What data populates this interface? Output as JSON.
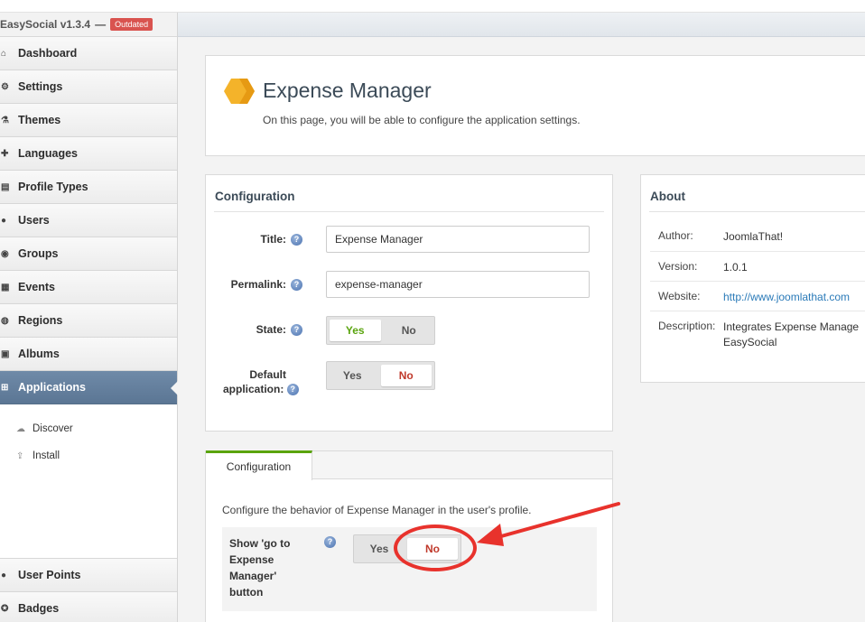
{
  "brand": {
    "name": "EasySocial v1.3.4",
    "separator": "—",
    "badge": "Outdated"
  },
  "sidebar": {
    "items": [
      {
        "label": "Dashboard",
        "icon": "home-icon"
      },
      {
        "label": "Settings",
        "icon": "gear-icon"
      },
      {
        "label": "Themes",
        "icon": "flask-icon"
      },
      {
        "label": "Languages",
        "icon": "puzzle-icon"
      },
      {
        "label": "Profile Types",
        "icon": "id-card-icon"
      },
      {
        "label": "Users",
        "icon": "user-icon"
      },
      {
        "label": "Groups",
        "icon": "group-icon"
      },
      {
        "label": "Events",
        "icon": "calendar-icon"
      },
      {
        "label": "Regions",
        "icon": "globe-icon"
      },
      {
        "label": "Albums",
        "icon": "album-icon"
      },
      {
        "label": "Applications",
        "icon": "plus-box-icon",
        "active": true
      }
    ],
    "subitems": [
      {
        "label": "Discover",
        "icon": "cloud-icon"
      },
      {
        "label": "Install",
        "icon": "upload-icon"
      }
    ],
    "bottom_items": [
      {
        "label": "User Points",
        "icon": "circle-icon"
      },
      {
        "label": "Badges",
        "icon": "badge-icon"
      }
    ]
  },
  "page": {
    "title": "Expense Manager",
    "description": "On this page, you will be able to configure the application settings."
  },
  "config": {
    "heading": "Configuration",
    "title_label": "Title:",
    "title_value": "Expense Manager",
    "permalink_label": "Permalink:",
    "permalink_value": "expense-manager",
    "state_label": "State:",
    "state_yes": "Yes",
    "state_no": "No",
    "state_selected": "Yes",
    "default_label_1": "Default",
    "default_label_2": "application:",
    "default_yes": "Yes",
    "default_no": "No",
    "default_selected": "No"
  },
  "about": {
    "heading": "About",
    "rows": [
      {
        "key": "Author:",
        "value": "JoomlaThat!"
      },
      {
        "key": "Version:",
        "value": "1.0.1"
      },
      {
        "key": "Website:",
        "value": "http://www.joomlathat.com"
      },
      {
        "key": "Description:",
        "value": "Integrates Expense Manage",
        "value2": "EasySocial"
      }
    ]
  },
  "profile_tab": {
    "tab_label": "Configuration",
    "description": "Configure the behavior of Expense Manager in the user's profile.",
    "setting_label": "Show 'go to Expense Manager' button",
    "yes": "Yes",
    "no": "No",
    "selected": "No"
  },
  "colors": {
    "accent_green": "#5aa40e",
    "active_nav": "#5b7694",
    "annotation_red": "#e8322c",
    "no_red": "#c0392b"
  }
}
